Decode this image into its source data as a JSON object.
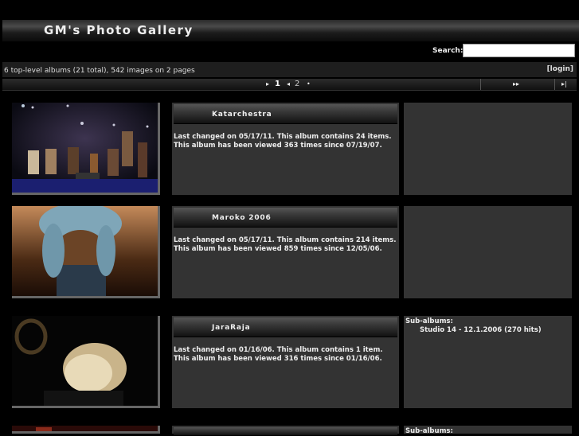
{
  "header": {
    "title": "GM's Photo Gallery"
  },
  "search": {
    "label": "Search:",
    "value": ""
  },
  "info": {
    "summary": "6 top-level albums (21 total), 542 images on 2 pages",
    "login": "[login]"
  },
  "pager": {
    "current": "1",
    "next": "2"
  },
  "albums": [
    {
      "title": "Katarchestra",
      "line1": "Last changed on 05/17/11. This album contains 24 items.",
      "line2": "This album has been viewed 363 times since 07/19/07.",
      "subalbums_heading": "",
      "subalbum": ""
    },
    {
      "title": "Maroko 2006",
      "line1": "Last changed on 05/17/11. This album contains 214 items.",
      "line2": "This album has been viewed 859 times since 12/05/06.",
      "subalbums_heading": "",
      "subalbum": ""
    },
    {
      "title": "JaraRaja",
      "line1": "Last changed on 01/16/06. This album contains 1 item.",
      "line2": "This album has been viewed 316 times since 01/16/06.",
      "subalbums_heading": "Sub-albums:",
      "subalbum": "Studio 14 - 12.1.2006 (270 hits)"
    },
    {
      "title": "",
      "line1": "",
      "line2": "",
      "subalbums_heading": "Sub-albums:",
      "subalbum": ""
    }
  ]
}
